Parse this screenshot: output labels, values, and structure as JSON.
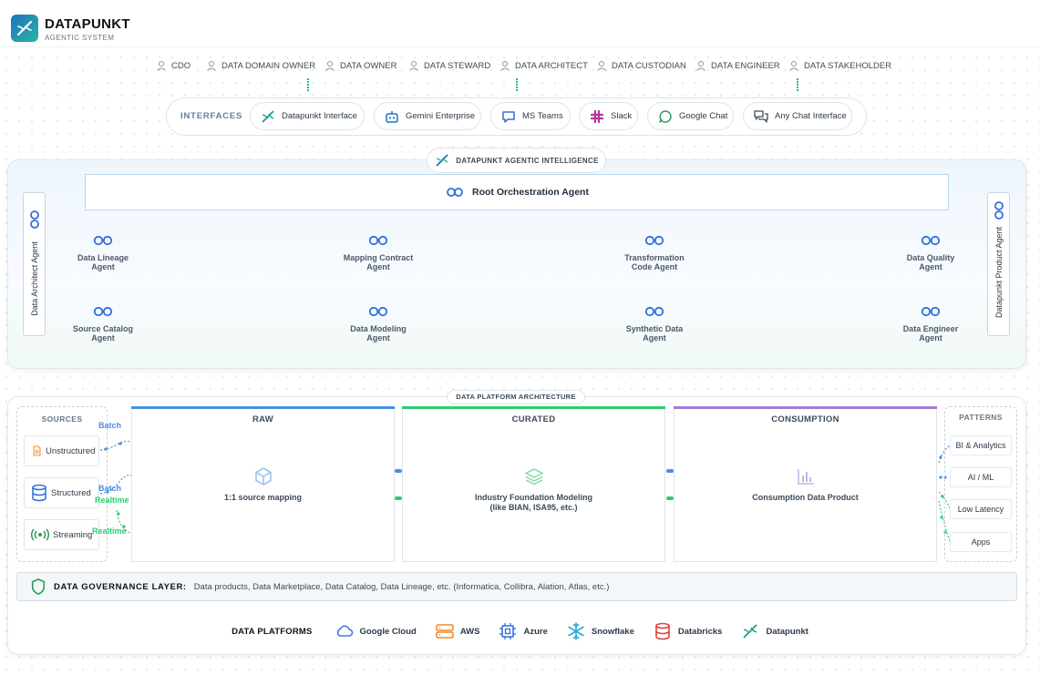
{
  "header": {
    "brand": "DATAPUNKT",
    "subtitle": "AGENTIC SYSTEM"
  },
  "roles": [
    "CDO",
    "DATA DOMAIN OWNER",
    "DATA OWNER",
    "DATA STEWARD",
    "DATA ARCHITECT",
    "DATA CUSTODIAN",
    "DATA ENGINEER",
    "DATA STAKEHOLDER"
  ],
  "interfaces": {
    "label": "INTERFACES",
    "items": [
      "Datapunkt Interface",
      "Gemini Enterprise",
      "MS Teams",
      "Slack",
      "Google Chat",
      "Any Chat Interface"
    ]
  },
  "agentic": {
    "badge": "DATAPUNKT AGENTIC INTELLIGENCE",
    "root": "Root Orchestration Agent",
    "left_agent": "Data Architect Agent",
    "right_agent": "Datapunkt Product Agent",
    "agents": [
      [
        "Data Lineage",
        "Agent"
      ],
      [
        "Mapping Contract",
        "Agent"
      ],
      [
        "Transformation",
        "Code Agent"
      ],
      [
        "Data Quality",
        "Agent"
      ],
      [
        "Source Catalog",
        "Agent"
      ],
      [
        "Data Modeling",
        "Agent"
      ],
      [
        "Synthetic Data",
        "Agent"
      ],
      [
        "Data Engineer",
        "Agent"
      ]
    ]
  },
  "architecture": {
    "badge": "DATA PLATFORM ARCHITECTURE",
    "sources": {
      "title": "SOURCES",
      "items": [
        "Unstructured",
        "Structured",
        "Streaming"
      ]
    },
    "flows": {
      "batch": "Batch",
      "realtime": "Realtime"
    },
    "stages": [
      {
        "title": "RAW",
        "desc1": "1:1 source mapping",
        "desc2": "",
        "color": "#4a90e2"
      },
      {
        "title": "CURATED",
        "desc1": "Industry Foundation Modeling",
        "desc2": "(like BIAN, ISA95, etc.)",
        "color": "#2ecc71"
      },
      {
        "title": "CONSUMPTION",
        "desc1": "Consumption Data Product",
        "desc2": "",
        "color": "#a07cd8"
      }
    ],
    "patterns": {
      "title": "PATTERNS",
      "items": [
        "BI & Analytics",
        "AI / ML",
        "Low Latency",
        "Apps"
      ]
    }
  },
  "governance": {
    "label": "DATA GOVERNANCE LAYER:",
    "desc": "Data products, Data Marketplace, Data Catalog, Data Lineage, etc. (Informatica, Collibra, Alation, Atlas, etc.)"
  },
  "platforms": {
    "label": "DATA PLATFORMS",
    "items": [
      "Google Cloud",
      "AWS",
      "Azure",
      "Snowflake",
      "Databricks",
      "Datapunkt"
    ]
  },
  "colors": {
    "accent": "#1e73be",
    "teal": "#26b5a6",
    "batch": "#4a90e2",
    "realtime": "#2ecc71",
    "consumption": "#a07cd8"
  }
}
